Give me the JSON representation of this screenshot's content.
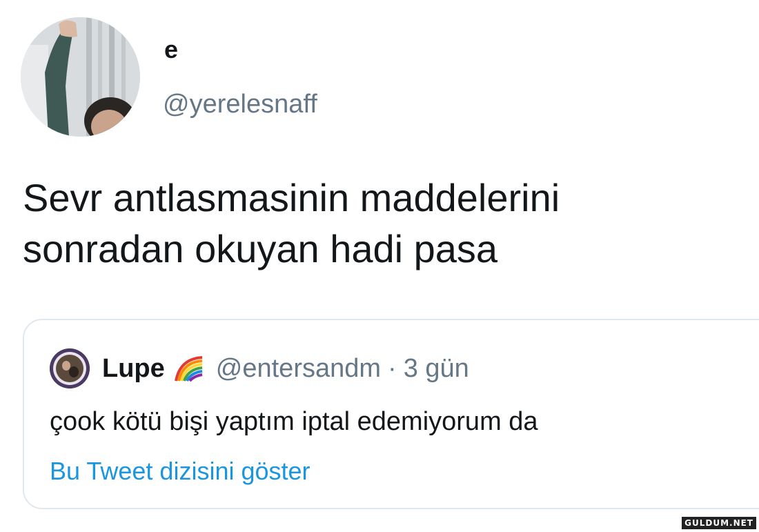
{
  "author": {
    "display_name": "e",
    "handle": "@yerelesnaff",
    "avatar_icon": "profile-photo"
  },
  "tweet": {
    "text_lines": [
      "Sevr antlasmasinin maddelerini",
      "sonradan okuyan hadi pasa"
    ]
  },
  "quoted_tweet": {
    "display_name": "Lupe",
    "name_emoji": "rainbow-icon",
    "handle": "@entersandm",
    "separator": "·",
    "time": "3 gün",
    "text": "çook kötü bişi yaptım iptal edemiyorum da",
    "show_thread_label": "Bu Tweet dizisini göster"
  },
  "watermark": "GULDUM.NET",
  "colors": {
    "text_primary": "#14171a",
    "text_secondary": "#657786",
    "link": "#1b95e0",
    "border": "#e1e8ed"
  }
}
